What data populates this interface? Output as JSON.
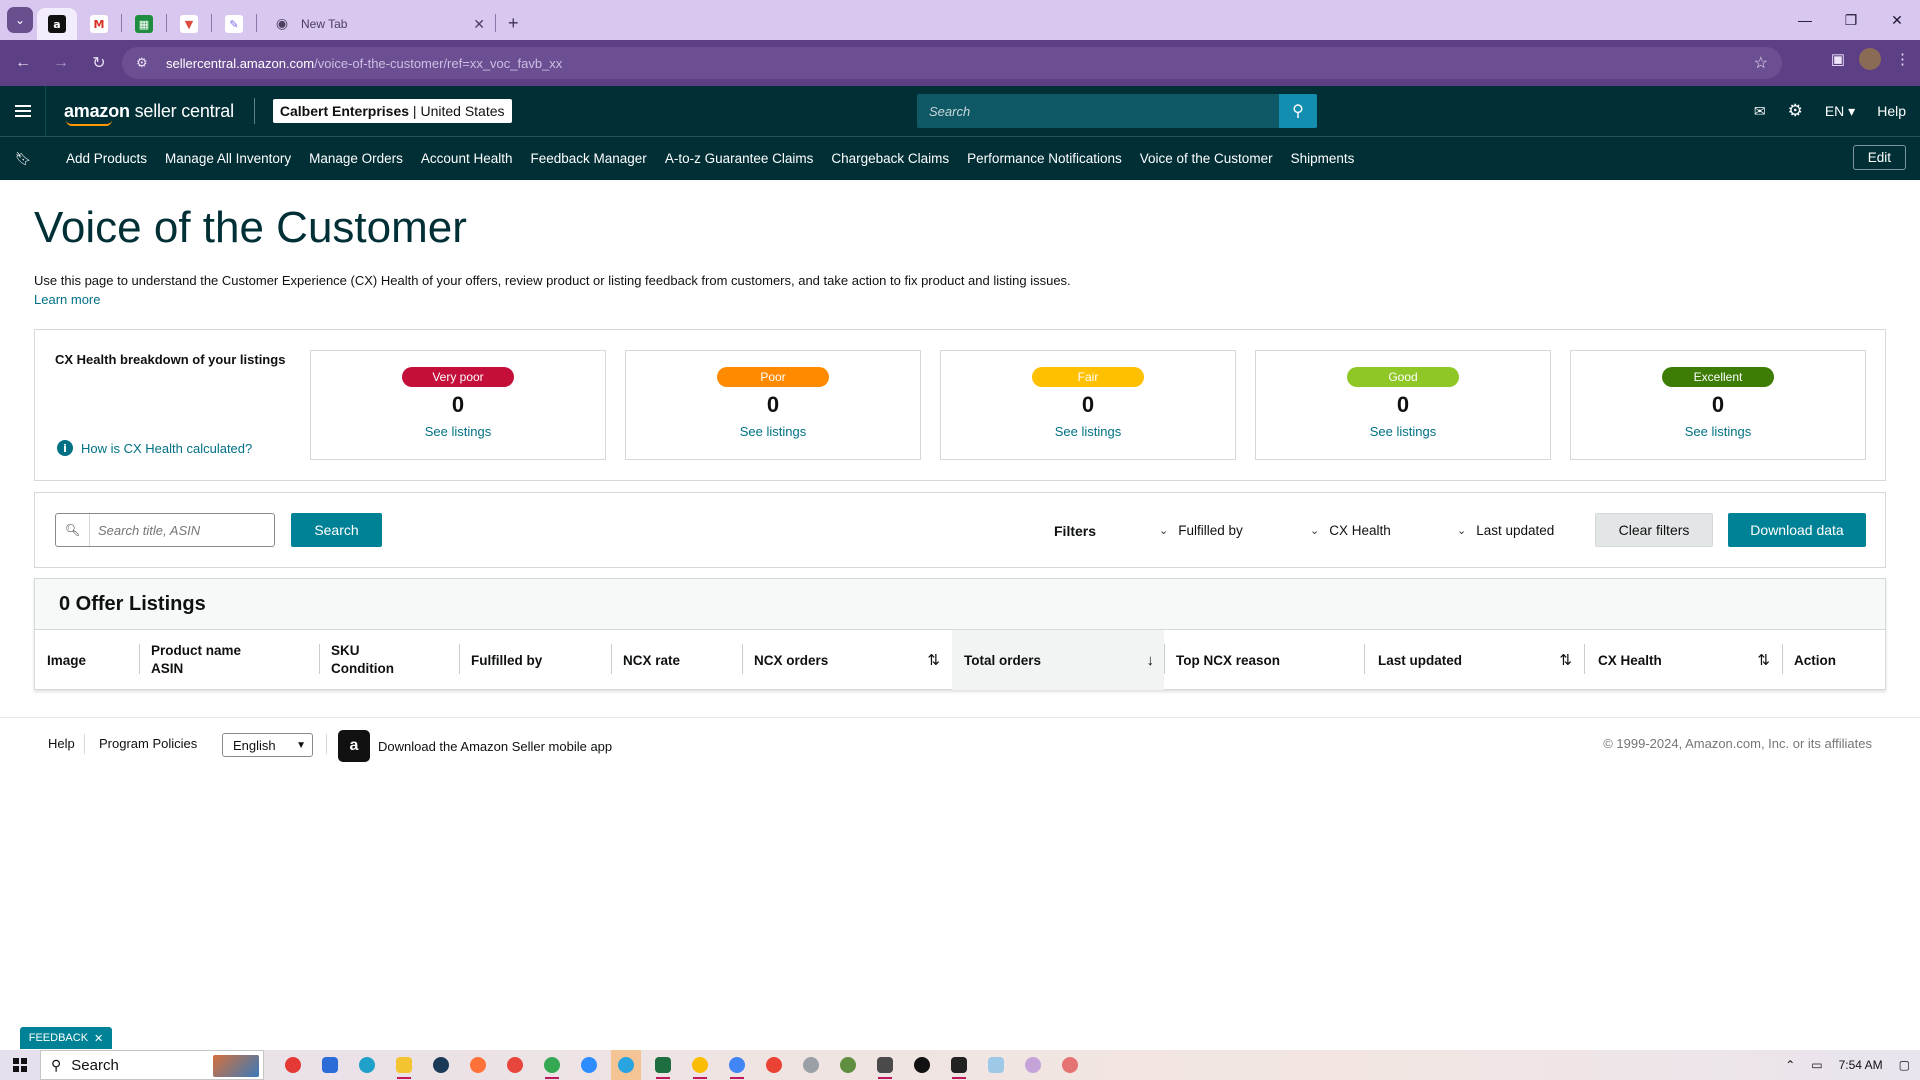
{
  "browser": {
    "tabs": [
      {
        "name": "amazon",
        "glyph": "a",
        "bg": "#111111",
        "fg": "#ffffff"
      },
      {
        "name": "gmail",
        "glyph": "M",
        "bg": "#ffffff",
        "fg": "#d93025"
      },
      {
        "name": "sheets",
        "glyph": "▦",
        "bg": "#1e8e3e",
        "fg": "#ffffff"
      },
      {
        "name": "todoist",
        "glyph": "▼",
        "bg": "#ffffff",
        "fg": "#db4c3f"
      },
      {
        "name": "clickup",
        "glyph": "✎",
        "bg": "#ffffff",
        "fg": "#7b68ee"
      }
    ],
    "newtab_title": "New Tab",
    "url_host": "sellercentral.amazon.com",
    "url_path": "/voice-of-the-customer/ref=xx_voc_favb_xx"
  },
  "header": {
    "logo_bold": "amazon",
    "logo_rest": " seller central",
    "account_name": "Calbert Enterprises",
    "account_region": " | United States",
    "search_placeholder": "Search",
    "lang": "EN",
    "help": "Help"
  },
  "nav": {
    "items": [
      "Add Products",
      "Manage All Inventory",
      "Manage Orders",
      "Account Health",
      "Feedback Manager",
      "A-to-z Guarantee Claims",
      "Chargeback Claims",
      "Performance Notifications",
      "Voice of the Customer",
      "Shipments"
    ],
    "edit": "Edit"
  },
  "page": {
    "title": "Voice of the Customer",
    "description": "Use this page to understand the Customer Experience (CX) Health of your offers, review product or listing feedback from customers, and take action to fix product and listing issues.",
    "learn_more": "Learn more"
  },
  "cx": {
    "heading": "CX Health breakdown of your listings",
    "how_link": "How is CX Health calculated?",
    "categories": [
      {
        "label": "Very poor",
        "count": "0",
        "link": "See listings",
        "color": "#c40f3b"
      },
      {
        "label": "Poor",
        "count": "0",
        "link": "See listings",
        "color": "#ff8a00"
      },
      {
        "label": "Fair",
        "count": "0",
        "link": "See listings",
        "color": "#ffc000"
      },
      {
        "label": "Good",
        "count": "0",
        "link": "See listings",
        "color": "#8fc727"
      },
      {
        "label": "Excellent",
        "count": "0",
        "link": "See listings",
        "color": "#3d7d06"
      }
    ]
  },
  "filters": {
    "search_placeholder": "Search title, ASIN",
    "search_button": "Search",
    "label": "Filters",
    "fulfilled_by": "Fulfilled by",
    "cx_health": "CX Health",
    "last_updated": "Last updated",
    "clear": "Clear filters",
    "download": "Download data"
  },
  "listings": {
    "heading": "0 Offer Listings",
    "columns": {
      "image": "Image",
      "product_name": "Product name",
      "asin": "ASIN",
      "sku": "SKU",
      "condition": "Condition",
      "fulfilled_by": "Fulfilled by",
      "ncx_rate": "NCX rate",
      "ncx_orders": "NCX orders",
      "total_orders": "Total orders",
      "top_reason": "Top NCX reason",
      "last_updated": "Last updated",
      "cx_health": "CX Health",
      "action": "Action"
    }
  },
  "footer": {
    "help": "Help",
    "policies": "Program Policies",
    "language": "English",
    "app": "Download the Amazon Seller mobile app",
    "copyright": "© 1999-2024, Amazon.com, Inc. or its affiliates"
  },
  "feedback_tab": "FEEDBACK",
  "taskbar": {
    "search": "Search",
    "time": "7:54 AM"
  }
}
